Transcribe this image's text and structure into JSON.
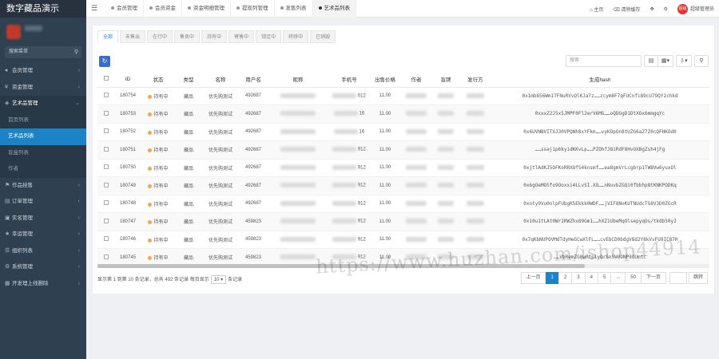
{
  "sidebar": {
    "brand": "数字藏品演示",
    "search_placeholder": "搜索菜单",
    "items": [
      {
        "label": "会员管理",
        "icon": "user-icon"
      },
      {
        "label": "资金管理",
        "icon": "money-icon"
      },
      {
        "label": "艺术品管理",
        "icon": "palette-icon"
      }
    ],
    "subitems": [
      {
        "label": "首页列表"
      },
      {
        "label": "艺术品列表"
      },
      {
        "label": "盲盒列表"
      },
      {
        "label": "作者"
      }
    ],
    "items_after": [
      {
        "label": "作品挂售",
        "icon": "tag-icon"
      },
      {
        "label": "订单管理",
        "icon": "order-icon"
      },
      {
        "label": "实名管理",
        "icon": "idcard-icon"
      },
      {
        "label": "幸运管理",
        "icon": "star-icon"
      },
      {
        "label": "组织列表",
        "icon": "list-icon"
      },
      {
        "label": "系统管理",
        "icon": "gear-icon"
      },
      {
        "label": "开发理上线删除",
        "icon": "grid-icon"
      }
    ]
  },
  "topbar": {
    "tabs": [
      {
        "label": "会员管理"
      },
      {
        "label": "会员资金"
      },
      {
        "label": "资金明细管理"
      },
      {
        "label": "提现列管理"
      },
      {
        "label": "发售列表"
      },
      {
        "label": "艺术品列表"
      }
    ],
    "home": "主页",
    "clear_cache": "清除缓存",
    "user_badge": "超级",
    "user_name": "超级管理员"
  },
  "filters": {
    "status_tabs": [
      "全部",
      "未售出",
      "在行中",
      "售卖中",
      "持有中",
      "寄售中",
      "锁定中",
      "转移中",
      "已销毁"
    ]
  },
  "toolbar": {
    "search_placeholder": "搜索"
  },
  "table": {
    "columns": [
      "ID",
      "状态",
      "类型",
      "名称",
      "用户名",
      "昵称",
      "手机号",
      "出售价格",
      "作者",
      "盲牌",
      "发行方",
      "生成hash"
    ],
    "rows": [
      {
        "id": "180754",
        "status": "持有中",
        "type": "藏品",
        "name": "优先购测试",
        "user": "492687",
        "phone": "012",
        "price": "11.00",
        "hash": "0x1mb856Wm1TFNuRVvQlKJa7z……zcym8F7qFUCnfi89cU79QY2chkd"
      },
      {
        "id": "180753",
        "status": "持有中",
        "type": "藏品",
        "name": "优先购测试",
        "user": "492687",
        "phone": "16",
        "price": "11.00",
        "hash": "0xxxZ2J5x5JMPF0Fl2erV6MG……oQDGgD1DtXOx6mmgqYc"
      },
      {
        "id": "180752",
        "status": "持有中",
        "type": "藏品",
        "name": "优先购测试",
        "user": "492687",
        "phone": "16",
        "price": "11.00",
        "hash": "0x6UVNBVITXJ30VPQNh8xYFkm……vyKOpOn8tUZG6aZ7Z0cQFHKOd0"
      },
      {
        "id": "180751",
        "status": "持有中",
        "type": "藏品",
        "name": "优先购测试",
        "user": "492687",
        "phone": "912",
        "price": "11.00",
        "hash": "……ssaj1p6kyidKKvLp……PZOhfJ8iRdF8HvOXBgZsh4jFg"
      },
      {
        "id": "180750",
        "status": "持有中",
        "type": "藏品",
        "name": "优先购测试",
        "user": "492687",
        "phone": "912",
        "price": "11.00",
        "hash": "0xjtlAdKJ5OFKoRRXOfS4knsmf……ea8gmVrLcgbrp1TWBVw6yuxOl"
      },
      {
        "id": "180749",
        "status": "持有中",
        "type": "藏品",
        "name": "优先购测试",
        "user": "492687",
        "phone": "912",
        "price": "11.00",
        "hash": "0x6gOeMO5fo9Ooxxi4LLvSI.XO……nNuvbZGQi0fbbhp8tKNKPODKq"
      },
      {
        "id": "180748",
        "status": "持有中",
        "type": "藏品",
        "name": "优先购测试",
        "user": "492687",
        "phone": "912",
        "price": "11.00",
        "hash": "0xoty9Vu0nlpFUbgK5Ekkk0WDF……jVIF8NoKUTNUdcTG8V3D0ZGcR"
      },
      {
        "id": "180747",
        "status": "持有中",
        "type": "藏品",
        "name": "优先购测试",
        "user": "459823",
        "phone": "912",
        "price": "11.00",
        "hash": "0x10u1tLAt0Wr1RWZhx89Gm1……hXZ1UbeMqOlsepyqOs/tkdb50y2"
      },
      {
        "id": "180746",
        "status": "持有中",
        "type": "藏品",
        "name": "优先购测试",
        "user": "459823",
        "phone": "912",
        "price": "11.00",
        "hash": "0x7qKbNUPOVMdTdyHeGCwXlFL……cvEbCD0bdgV8d2Y8kVvFU9IC87H"
      },
      {
        "id": "180745",
        "status": "持有中",
        "type": "藏品",
        "name": "优先购测试",
        "user": "459823",
        "phone": "912",
        "price": "11.00",
        "hash": "……VbRemZG8wRtp1yQrSnSVUONP1dUmtc"
      }
    ]
  },
  "footer": {
    "info_before": "显示第 1 到第 10 条记录，总共 492 条记录 每页显示",
    "page_size": "10",
    "info_after": "条记录",
    "prev": "上一页",
    "pages": [
      "1",
      "2",
      "3",
      "4",
      "5",
      "...",
      "50"
    ],
    "next": "下一页",
    "jump": "跳转"
  },
  "watermark": "https://www.huzhan.com/ishop44914"
}
